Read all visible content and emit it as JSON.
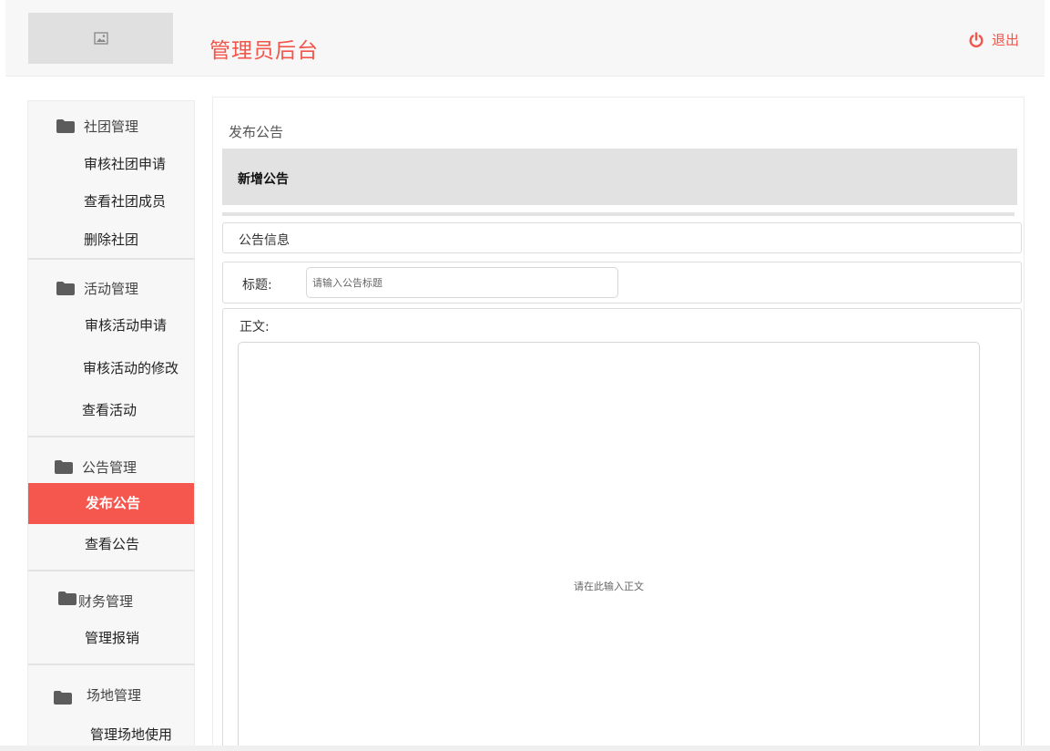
{
  "header": {
    "logo_icon": "image-icon",
    "title": "管理员后台",
    "logout_icon": "power-icon",
    "logout_label": "退出"
  },
  "colors": {
    "accent": "#f5574f",
    "header_bg": "#f7f7f7",
    "sidebar_bg": "#f7f7f7",
    "tab_bg": "#e2e2e2"
  },
  "sidebar": {
    "groups": [
      {
        "icon": "folder-icon",
        "label": "社团管理",
        "items": [
          "审核社团申请",
          "查看社团成员",
          "删除社团"
        ]
      },
      {
        "icon": "folder-icon",
        "label": "活动管理",
        "items": [
          "审核活动申请",
          "审核活动的修改",
          "查看活动"
        ]
      },
      {
        "icon": "folder-icon",
        "label": "公告管理",
        "items": [
          "发布公告",
          "查看公告"
        ]
      },
      {
        "icon": "folder-icon",
        "label": "财务管理",
        "items": [
          "管理报销"
        ]
      },
      {
        "icon": "folder-icon",
        "label": "场地管理",
        "items": [
          "管理场地使用"
        ]
      }
    ],
    "active_item": "发布公告"
  },
  "main": {
    "heading": "发布公告",
    "tab_label": "新增公告",
    "section_label": "公告信息",
    "title_label": "标题:",
    "title_placeholder": "请输入公告标题",
    "title_value": "",
    "body_label": "正文:",
    "body_placeholder": "请在此输入正文"
  }
}
